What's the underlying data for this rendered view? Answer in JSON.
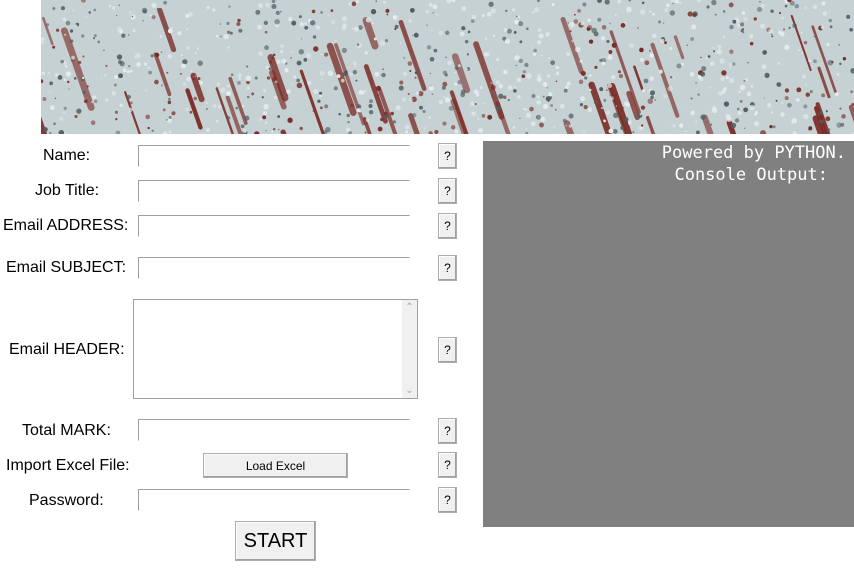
{
  "banner": {
    "texture_colors": {
      "base": "#c6d1d4",
      "speck_light": "#e6ecee",
      "speck_dark": "#4e5f64",
      "rust": "#7a2a24"
    }
  },
  "form": {
    "name": {
      "label": "Name:",
      "value": ""
    },
    "job_title": {
      "label": "Job Title:",
      "value": ""
    },
    "email_address": {
      "label": "Email ADDRESS:",
      "value": ""
    },
    "email_subject": {
      "label": "Email SUBJECT:",
      "value": ""
    },
    "email_header": {
      "label": "Email HEADER:",
      "value": ""
    },
    "total_mark": {
      "label": "Total MARK:",
      "value": ""
    },
    "import_excel": {
      "label": "Import Excel File:",
      "button_label": "Load Excel"
    },
    "password": {
      "label": "Password:",
      "value": ""
    },
    "help_label": "?",
    "start_label": "START"
  },
  "console": {
    "background": "#808080",
    "text_color": "#ffffff",
    "lines": [
      "Powered by PYTHON.",
      "Console Output:"
    ]
  }
}
